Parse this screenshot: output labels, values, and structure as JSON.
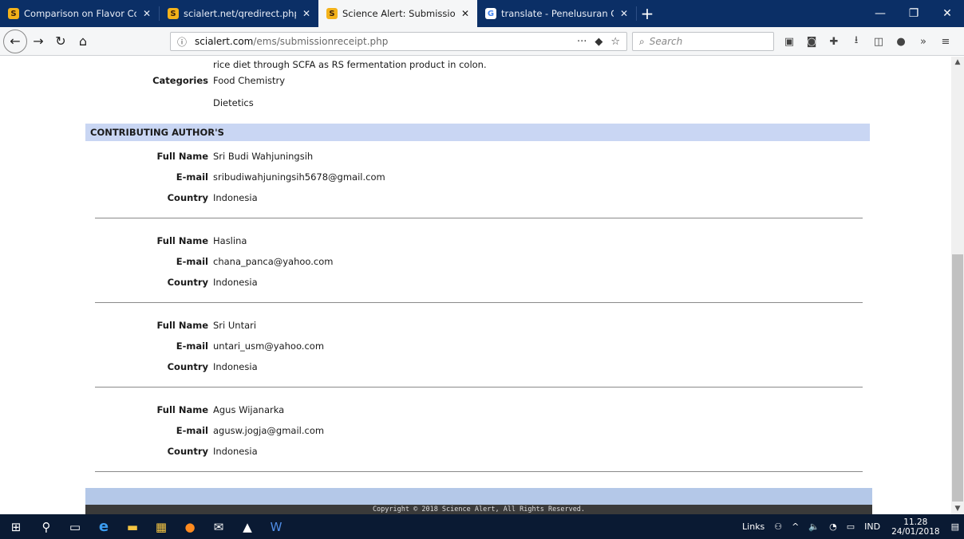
{
  "browser": {
    "tabs": [
      {
        "label": "Comparison on Flavor Compou",
        "favicon": "scialert-icon",
        "active": false
      },
      {
        "label": "scialert.net/qredirect.php?doi=",
        "favicon": "scialert-icon",
        "active": false
      },
      {
        "label": "Science Alert: Submission Syste",
        "favicon": "scialert-icon",
        "active": true
      },
      {
        "label": "translate - Penelusuran Google",
        "favicon": "google-icon",
        "active": false
      }
    ],
    "tab_close": "✕",
    "new_tab": "+",
    "url": {
      "host": "scialert.com",
      "path": "/ems/submissionreceipt.php",
      "ellipsis": "···"
    },
    "search_placeholder": "Search"
  },
  "page": {
    "abstract_tail": "rice diet through SCFA as RS fermentation product in colon.",
    "categories_label": "Categories",
    "categories": [
      "Food Chemistry",
      "Dietetics"
    ],
    "section_title": "CONTRIBUTING AUTHOR'S",
    "labels": {
      "full_name": "Full Name",
      "email": "E-mail",
      "country": "Country"
    },
    "authors": [
      {
        "full_name": "Sri Budi Wahjuningsih",
        "email": "sribudiwahjuningsih5678@gmail.com",
        "country": "Indonesia"
      },
      {
        "full_name": "Haslina",
        "email": "chana_panca@yahoo.com",
        "country": "Indonesia"
      },
      {
        "full_name": "Sri Untari",
        "email": "untari_usm@yahoo.com",
        "country": "Indonesia"
      },
      {
        "full_name": "Agus Wijanarka",
        "email": "agusw.jogja@gmail.com",
        "country": "Indonesia"
      }
    ],
    "copyright": "Copyright © 2018 Science Alert, All Rights Reserved."
  },
  "taskbar": {
    "links_label": "Links",
    "language": "IND",
    "time": "11.28",
    "date": "24/01/2018"
  },
  "colors": {
    "tabstrip": "#0b2f66",
    "section_band": "#c9d6f3",
    "footer_band": "#b4c8e8",
    "copyright_bar": "#3a3a3a",
    "taskbar": "#0a1a33"
  }
}
